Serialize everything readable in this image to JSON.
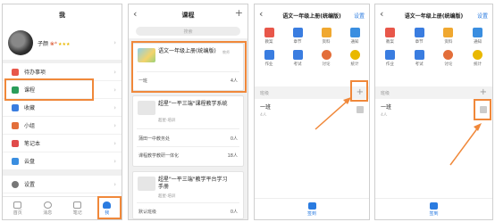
{
  "p1": {
    "title": "我",
    "username": "子颜",
    "flair": "❀*",
    "stars": "★★★",
    "menu": [
      {
        "label": "待办事项",
        "icon": "todo-icon",
        "color": "#e8574a"
      },
      {
        "label": "课程",
        "icon": "course-icon",
        "color": "#2a9d5a"
      },
      {
        "label": "收藏",
        "icon": "favorite-icon",
        "color": "#3a7de0"
      },
      {
        "label": "小组",
        "icon": "group-icon",
        "color": "#e36e3a"
      },
      {
        "label": "笔记本",
        "icon": "notebook-icon",
        "color": "#e04a4a"
      },
      {
        "label": "云盘",
        "icon": "cloud-icon",
        "color": "#3a8ee0"
      }
    ],
    "settings": "设置",
    "tabs": [
      "首页",
      "消息",
      "笔记",
      "我"
    ]
  },
  "p2": {
    "title": "课程",
    "search_placeholder": "搜索",
    "course1": {
      "title": "语文一年级上册(统编版)",
      "badge": "教师",
      "class": "一班",
      "count": "4人"
    },
    "course2": {
      "title": "超星\"一平三端\"课程教学系统",
      "sub": "超星·培训",
      "row1": "蒲田一中教务处",
      "row1_count": "0人",
      "row2": "课程教学教研一体化",
      "row2_count": "18人"
    },
    "course3": {
      "title": "超星\"一平三端\"教学平台学习手册",
      "sub": "超星·培训",
      "row1": "默认班级",
      "row1_count": "0人"
    }
  },
  "p3": {
    "title": "语文一年级上册(统编版)",
    "right": "设置",
    "grid": [
      "教案",
      "章节",
      "资料",
      "通知",
      "作业",
      "考试",
      "讨论",
      "统计"
    ],
    "grid_colors": [
      "#e8574a",
      "#3a7de0",
      "#f0a830",
      "#3a8ee0",
      "#3a7de0",
      "#3a7de0",
      "#e36e3a",
      "#e9b800"
    ],
    "class_header": "班级",
    "class_name": "一班",
    "class_sub": "4人",
    "bottom": "签到"
  },
  "p4": {
    "title": "语文一年级上册(统编版)",
    "right": "设置",
    "grid": [
      "教案",
      "章节",
      "资料",
      "通知",
      "作业",
      "考试",
      "讨论",
      "统计"
    ],
    "class_header": "班级",
    "class_name": "一班",
    "class_sub": "4人",
    "bottom": "签到"
  },
  "colors": {
    "accent": "#2a7be0",
    "highlight": "#f0883a"
  }
}
